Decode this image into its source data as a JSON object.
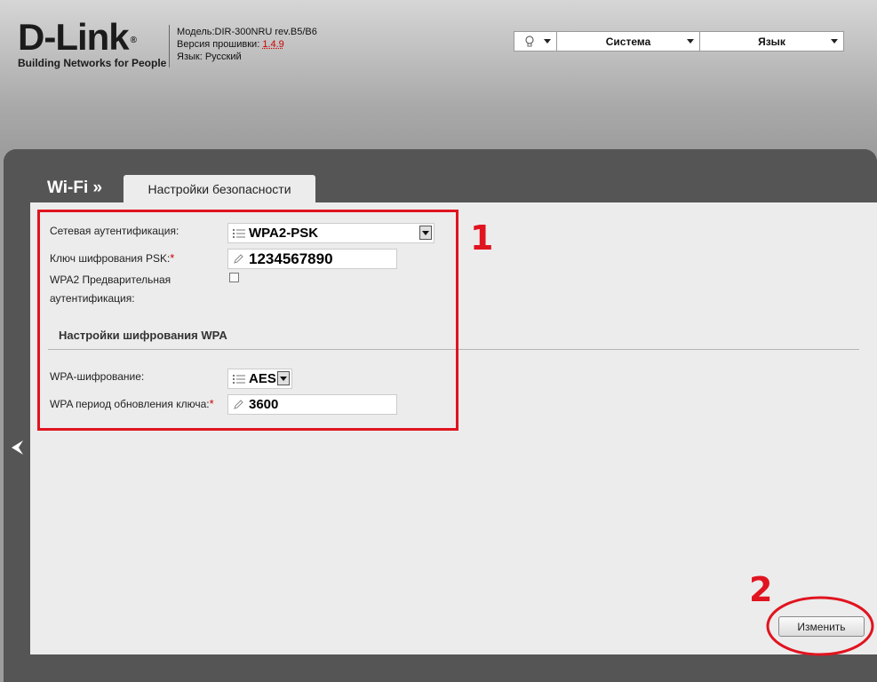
{
  "header": {
    "brand": "D-Link",
    "registered": "®",
    "tagline": "Building Networks for People",
    "model_line": "Модель:DIR-300NRU rev.B5/B6",
    "firmware_label": "Версия прошивки: ",
    "firmware_version": "1.4.9",
    "language_line": "Язык: Русский"
  },
  "topmenu": {
    "bulb_icon": "lightbulb-icon",
    "system_label": "Система",
    "language_label": "Язык"
  },
  "breadcrumb": {
    "section": "Wi-Fi »",
    "tab": "Настройки безопасности"
  },
  "form": {
    "auth_label": "Сетевая аутентификация:",
    "auth_value": "WPA2-PSK",
    "psk_label": "Ключ шифрования PSK:",
    "psk_value": "1234567890",
    "preauth_label_1": "WPA2 Предварительная",
    "preauth_label_2": "аутентификация:",
    "preauth_checked": false,
    "wpa_section_title": "Настройки шифрования WPA",
    "enc_label": "WPA-шифрование:",
    "enc_value": "AES",
    "rekey_label": "WPA период обновления ключа:",
    "rekey_value": "3600",
    "required_mark": "*"
  },
  "actions": {
    "apply_label": "Изменить"
  },
  "annotations": {
    "marker_1": "1",
    "marker_2": "2",
    "color": "#e0141f"
  }
}
